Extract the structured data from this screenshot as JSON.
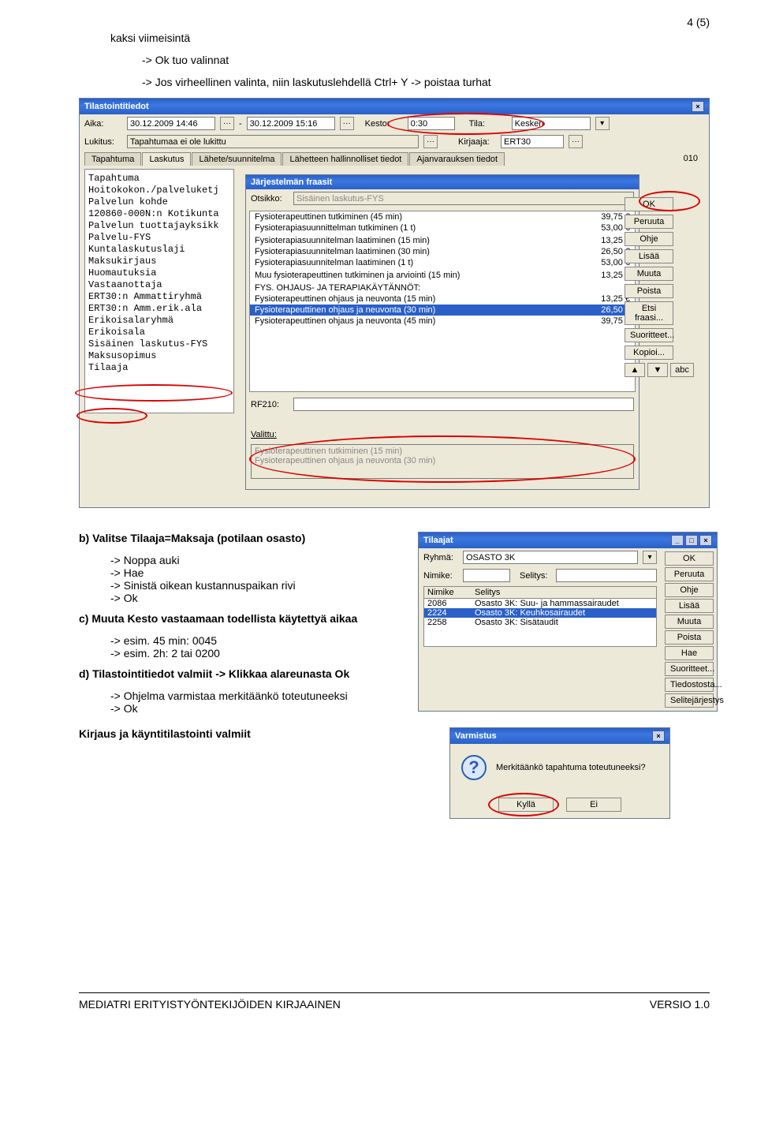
{
  "page": {
    "number": "4 (5)"
  },
  "intro": {
    "l1": "kaksi viimeisintä",
    "l2": "-> Ok tuo valinnat",
    "l3": "-> Jos virheellinen valinta, niin laskutuslehdellä Ctrl+ Y -> poistaa turhat"
  },
  "dlg1": {
    "title": "Tilastointitiedot",
    "aika_lbl": "Aika:",
    "aika_from": "30.12.2009 14:46",
    "aika_to": "30.12.2009 15:16",
    "kesto_lbl": "Kesto:",
    "kesto": "0:30",
    "tila_lbl": "Tila:",
    "tila": "Kesken",
    "lukitus_lbl": "Lukitus:",
    "lukitus": "Tapahtumaa ei ole lukittu",
    "kirjaaja_lbl": "Kirjaaja:",
    "kirjaaja": "ERT30",
    "tabs": [
      "Tapahtuma",
      "Laskutus",
      "Lähete/suunnitelma",
      "Lähetteen hallinnolliset tiedot",
      "Ajanvarauksen tiedot"
    ],
    "year": "010",
    "leftlist": [
      "Tapahtuma",
      "Hoitokokon./palveluketj",
      "Palvelun kohde",
      "120860-000N:n Kotikunta",
      "Palvelun tuottajayksikk",
      "Palvelu-FYS",
      "Kuntalaskutuslaji",
      "Maksukirjaus",
      "Huomautuksia",
      "",
      "Vastaanottaja",
      "ERT30:n Ammattiryhmä",
      "ERT30:n Amm.erik.ala",
      "",
      "Erikoisalaryhmä",
      "Erikoisala",
      "",
      "Sisäinen laskutus-FYS",
      "Maksusopimus",
      "Tilaaja"
    ]
  },
  "phrase": {
    "title": "Järjestelmän fraasit",
    "otsikko_lbl": "Otsikko:",
    "otsikko": "Sisäinen laskutus-FYS",
    "rows": [
      {
        "t": "Fysioterapeuttinen tutkiminen (45 min)",
        "p": "39,75 €"
      },
      {
        "t": "Fysioterapiasuunnittelman tutkiminen (1 t)",
        "p": "53,00 €"
      },
      {
        "t": "",
        "p": ""
      },
      {
        "t": "Fysioterapiasuunnitelman laatiminen (15 min)",
        "p": "13,25 €"
      },
      {
        "t": "Fysioterapiasuunnitelman laatiminen (30 min)",
        "p": "26,50 €"
      },
      {
        "t": "Fysioterapiasuunnitelman laatiminen (1 t)",
        "p": "53,00 €"
      },
      {
        "t": "",
        "p": ""
      },
      {
        "t": "Muu fysioterapeuttinen tutkiminen ja arviointi (15 min)",
        "p": "13,25 €"
      },
      {
        "t": "",
        "p": ""
      },
      {
        "t": "FYS. OHJAUS- JA TERAPIAKÄYTÄNNÖT:",
        "p": ""
      },
      {
        "t": "Fysioterapeuttinen ohjaus ja neuvonta (15 min)",
        "p": "13,25 €"
      },
      {
        "t": "Fysioterapeuttinen ohjaus ja neuvonta (30 min)",
        "p": "26,50 €",
        "sel": true
      },
      {
        "t": "Fysioterapeuttinen ohjaus ja neuvonta (45 min)",
        "p": "39,75 €"
      }
    ],
    "rf_lbl": "RF210:",
    "valittu_lbl": "Valittu:",
    "valittu1": "Fysioterapeuttinen tutkiminen (15 min)",
    "valittu2": "Fysioterapeuttinen ohjaus ja neuvonta (30 min)",
    "btns": [
      "OK",
      "Peruuta",
      "Ohje",
      "Lisää",
      "Muuta",
      "Poista",
      "Etsi fraasi...",
      "Suoritteet...",
      "Kopioi..."
    ],
    "up": "▲",
    "dn": "▼",
    "abc": "abc"
  },
  "section_b": {
    "head": "b) Valitse Tilaaja=Maksaja (potilaan osasto)",
    "l1": "-> Noppa auki",
    "l2": "-> Hae",
    "l3": "-> Sinistä oikean kustannuspaikan rivi",
    "l4": "-> Ok"
  },
  "section_c": {
    "head": "c) Muuta Kesto vastaamaan todellista käytettyä aikaa",
    "l1": "-> esim. 45 min: 0045",
    "l2": "-> esim. 2h: 2 tai 0200"
  },
  "section_d": {
    "head": "d) Tilastointitiedot valmiit -> Klikkaa alareunasta Ok",
    "l1": "-> Ohjelma varmistaa merkitäänkö toteutuneeksi",
    "l2": "-> Ok",
    "final": "Kirjaus ja käyntitilastointi valmiit"
  },
  "tilaajat": {
    "title": "Tilaajat",
    "ryhma_lbl": "Ryhmä:",
    "ryhma": "OSASTO 3K",
    "nimike_lbl": "Nimike:",
    "selitys_lbl": "Selitys:",
    "hdr1": "Nimike",
    "hdr2": "Selitys",
    "rows": [
      {
        "a": "2086",
        "b": "Osasto 3K: Suu- ja hammassairaudet"
      },
      {
        "a": "2224",
        "b": "Osasto 3K: Keuhkosairaudet",
        "sel": true
      },
      {
        "a": "2258",
        "b": "Osasto 3K: Sisätaudit"
      }
    ],
    "btns": [
      "OK",
      "Peruuta",
      "Ohje",
      "Lisää",
      "Muuta",
      "Poista",
      "Hae",
      "Suoritteet...",
      "Tiedostosta...",
      "Selitejärjestys"
    ]
  },
  "varm": {
    "title": "Varmistus",
    "q": "?",
    "msg": "Merkitäänkö tapahtuma toteutuneeksi?",
    "yes": "Kyllä",
    "no": "Ei"
  },
  "footer": {
    "left": "MEDIATRI ERITYISTYÖNTEKIJÖIDEN KIRJAAINEN",
    "right": "VERSIO 1.0"
  }
}
